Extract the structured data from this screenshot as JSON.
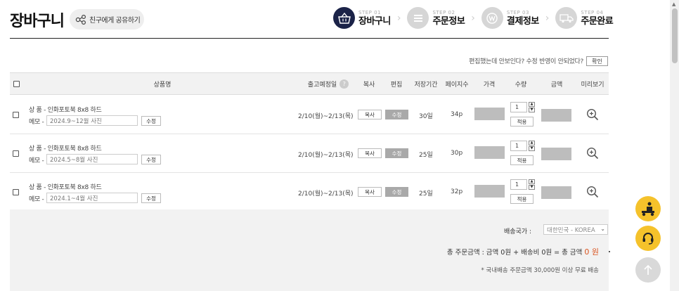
{
  "header": {
    "title": "장바구니",
    "share_label": "친구에게 공유하기"
  },
  "steps": [
    {
      "no": "STEP 01",
      "label": "장바구니",
      "icon": "basket-icon",
      "active": true
    },
    {
      "no": "STEP 02",
      "label": "주문정보",
      "icon": "list-icon",
      "active": false
    },
    {
      "no": "STEP 03",
      "label": "결제정보",
      "icon": "won-coin-icon",
      "active": false
    },
    {
      "no": "STEP 04",
      "label": "주문완료",
      "icon": "truck-icon",
      "active": false
    }
  ],
  "notice": {
    "text": "편집했는데 안보인다? 수정 반영이 안되었다?",
    "confirm_label": "확인"
  },
  "table": {
    "columns": {
      "product": "상품명",
      "ship_date": "출고예정일",
      "copy": "복사",
      "edit": "편집",
      "storage": "저장기간",
      "pages": "페이지수",
      "price": "가격",
      "qty": "수량",
      "amount": "금액",
      "preview": "미리보기"
    },
    "help_glyph": "?",
    "rows": [
      {
        "product": "상 품 - 인화포토북  8x8 하드",
        "memo_label": "메모 -",
        "memo": "2024.9~12월 사진",
        "memo_edit": "수정",
        "ship_date": "2/10(월)~2/13(목)",
        "copy": "복사",
        "edit": "수정",
        "storage": "30일",
        "pages": "34p",
        "qty": "1",
        "apply": "적용"
      },
      {
        "product": "상 품 - 인화포토북  8x8 하드",
        "memo_label": "메모 -",
        "memo": "2024.5~8월 사진",
        "memo_edit": "수정",
        "ship_date": "2/10(월)~2/13(목)",
        "copy": "복사",
        "edit": "수정",
        "storage": "25일",
        "pages": "30p",
        "qty": "1",
        "apply": "적용"
      },
      {
        "product": "상 품 - 인화포토북  8x8 하드",
        "memo_label": "메모 -",
        "memo": "2024.1~4월 사진",
        "memo_edit": "수정",
        "ship_date": "2/10(월)~2/13(목)",
        "copy": "복사",
        "edit": "수정",
        "storage": "25일",
        "pages": "32p",
        "qty": "1",
        "apply": "적용"
      }
    ]
  },
  "summary": {
    "country_label": "배송국가 :",
    "country_value": "대한민국 - KOREA",
    "total_text": "총 주문금액 : 금액 0원 + 배송비 0원 = 총 금액 ",
    "total_amount": "0 원",
    "free_shipping_note": "* 국내배송 주문금액 30,000원 이상 무료 배송"
  },
  "colors": {
    "step_active": "#1b2348",
    "accent_orange": "#d9531e",
    "float_yellow": "#f5c22b"
  }
}
